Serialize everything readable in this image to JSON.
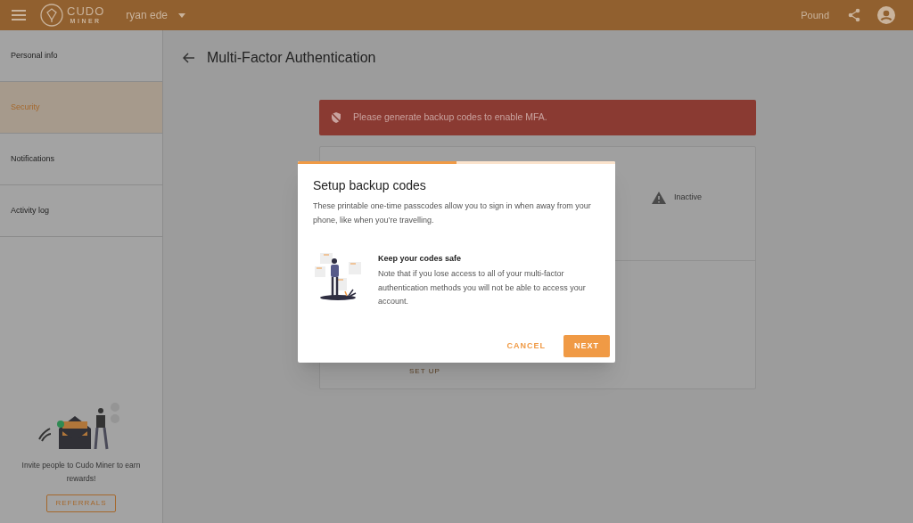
{
  "header": {
    "logo": [
      "CUDO",
      "MINER"
    ],
    "user": "ryan ede",
    "currency": "Pound"
  },
  "sidebar": {
    "items": [
      {
        "label": "Personal info",
        "selected": false
      },
      {
        "label": "Security",
        "selected": true
      },
      {
        "label": "Notifications",
        "selected": false
      },
      {
        "label": "Activity log",
        "selected": false
      }
    ],
    "promo": {
      "text": "Invite people to Cudo Miner to earn rewards!",
      "button": "REFERRALS"
    }
  },
  "page": {
    "title": "Multi-Factor Authentication",
    "alert": "Please generate backup codes to enable MFA.",
    "status": "Inactive",
    "action": "SET UP"
  },
  "dialog": {
    "progress": {
      "level": 0.5
    },
    "title": "Setup backup codes",
    "intro": "These printable one-time passcodes allow you to sign in when away from your phone, like when you’re travelling.",
    "subtitle": "Keep your codes safe",
    "note": "Note that if you lose access to all of your multi-factor authentication methods you will not be able to access your account.",
    "buttons": [
      "CANCEL",
      "NEXT"
    ]
  }
}
